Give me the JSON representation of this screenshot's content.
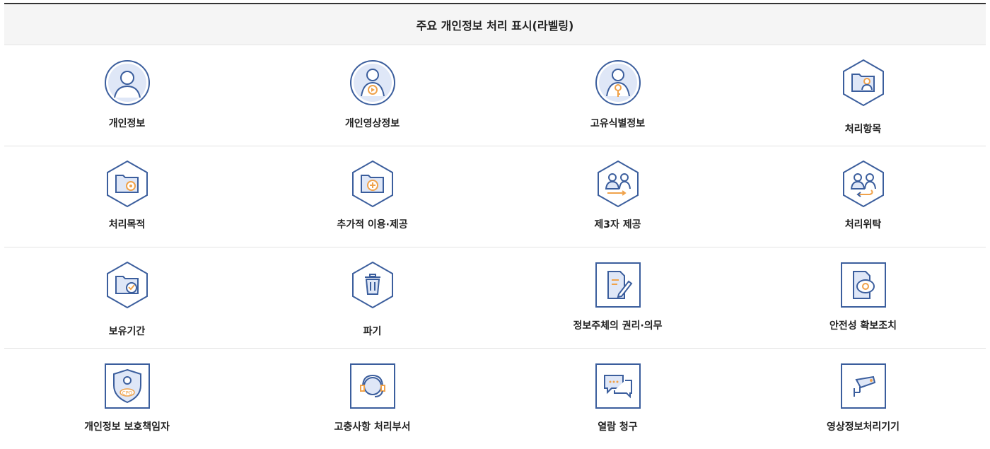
{
  "header": {
    "title": "주요 개인정보 처리 표시(라벨링)"
  },
  "colors": {
    "navy": "#3b5e9d",
    "orange": "#f0a24a",
    "light": "#dfe7f7",
    "line": "#e3e3e3"
  },
  "rows": [
    [
      {
        "label": "개인정보",
        "icon": "person-circle-icon"
      },
      {
        "label": "개인영상정보",
        "icon": "person-video-icon"
      },
      {
        "label": "고유식별정보",
        "icon": "person-key-icon"
      },
      {
        "label": "처리항목",
        "icon": "folder-person-icon"
      }
    ],
    [
      {
        "label": "처리목적",
        "icon": "folder-target-icon"
      },
      {
        "label": "추가적 이용·제공",
        "icon": "folder-plus-icon"
      },
      {
        "label": "제3자 제공",
        "icon": "people-third-party-icon"
      },
      {
        "label": "처리위탁",
        "icon": "people-return-icon"
      }
    ],
    [
      {
        "label": "보유기간",
        "icon": "folder-clock-icon"
      },
      {
        "label": "파기",
        "icon": "trash-icon"
      },
      {
        "label": "정보주체의 권리·의무",
        "icon": "document-pen-icon"
      },
      {
        "label": "안전성 확보조치",
        "icon": "document-shield-icon"
      }
    ],
    [
      {
        "label": "개인정보 보호책임자",
        "icon": "cpo-badge-icon"
      },
      {
        "label": "고충사항 처리부서",
        "icon": "headset-icon"
      },
      {
        "label": "열람 청구",
        "icon": "chat-bubbles-icon"
      },
      {
        "label": "영상정보처리기기",
        "icon": "cctv-camera-icon"
      }
    ]
  ]
}
